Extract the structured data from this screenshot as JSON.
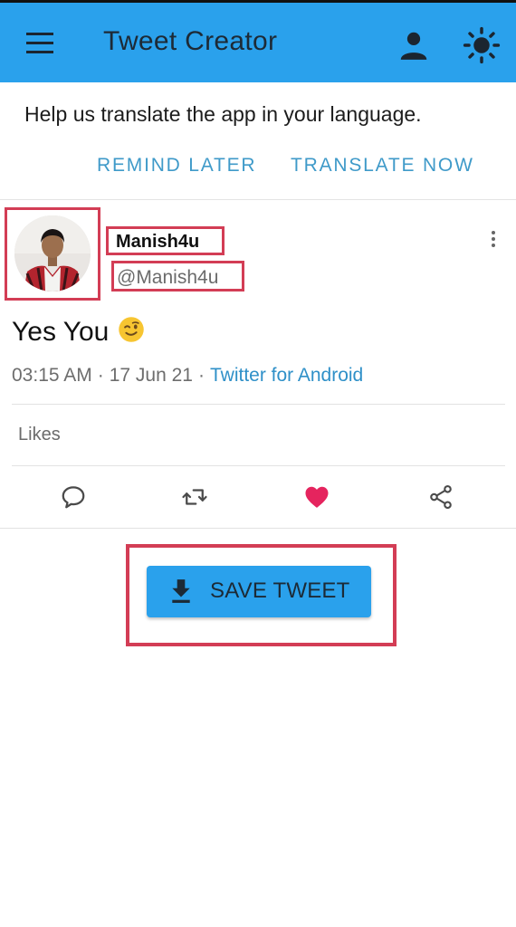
{
  "app": {
    "title": "Tweet Creator",
    "icons": {
      "menu": "hamburger-menu-icon",
      "user": "account-icon",
      "theme": "sun-icon"
    }
  },
  "banner": {
    "message": "Help us translate the app in your language.",
    "remind_label": "REMIND LATER",
    "translate_label": "TRANSLATE NOW"
  },
  "tweet": {
    "display_name": "Manish4u",
    "handle": "@Manish4u",
    "text": "Yes You",
    "emoji": "winking-face",
    "time": "03:15 AM",
    "date": "17 Jun 21",
    "source": "Twitter for Android",
    "separator": "·",
    "likes_label": "Likes",
    "liked": true,
    "actions": [
      "reply-icon",
      "retweet-icon",
      "heart-icon",
      "share-icon"
    ]
  },
  "save": {
    "label": "SAVE TWEET"
  },
  "colors": {
    "appbar": "#2aa1ec",
    "link": "#3f9ac9",
    "heart": "#e5245e",
    "highlight": "#d33d55"
  }
}
